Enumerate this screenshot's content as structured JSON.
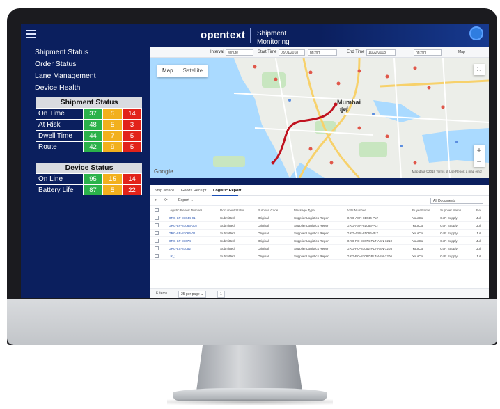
{
  "topbar": {
    "brand": "opentext",
    "app_title": "Shipment Monitoring"
  },
  "sidebar": {
    "nav": [
      "Shipment Status",
      "Order Status",
      "Lane Management",
      "Device Health"
    ],
    "shipment_status": {
      "title": "Shipment Status",
      "rows": [
        {
          "label": "On Time",
          "green": "37",
          "yellow": "5",
          "red": "14"
        },
        {
          "label": "At Risk",
          "green": "48",
          "yellow": "5",
          "red": "3"
        },
        {
          "label": "Dwell Time",
          "green": "44",
          "yellow": "7",
          "red": "5"
        },
        {
          "label": "Route",
          "green": "42",
          "yellow": "9",
          "red": "5"
        }
      ]
    },
    "device_status": {
      "title": "Device Status",
      "rows": [
        {
          "label": "On Line",
          "green": "95",
          "yellow": "15",
          "red": "14"
        },
        {
          "label": "Battery Life",
          "green": "87",
          "yellow": "5",
          "red": "22"
        }
      ]
    }
  },
  "filters": {
    "interval_label": "Interval",
    "interval_value": "Minute",
    "start_label": "Start Time",
    "start_value": "08/01/2018",
    "start_time_placeholder": "hh:mm",
    "end_label": "End Time",
    "end_value": "10/22/2018",
    "end_time_placeholder": "hh:mm",
    "map_button": "Map"
  },
  "map": {
    "tab_map": "Map",
    "tab_satellite": "Satellite",
    "city": "Mumbai",
    "city_local": "मुंबई",
    "google": "Google",
    "terms": "Map data ©2018   Terms of Use   Report a map error",
    "zoom_in": "+",
    "zoom_out": "−"
  },
  "documents": {
    "tabs": [
      "Ship Notice",
      "Goods Receipt",
      "Logistic Report"
    ],
    "active_tab": "Logistic Report",
    "export_label": "Export ⌄",
    "filter_value": "All Documents",
    "columns": [
      "Logistic Report Number",
      "Document Status",
      "Purpose Code",
      "Message Type",
      "ASN Number",
      "Buyer Name",
      "Supplier Name",
      "Re"
    ],
    "rows": [
      [
        "GRG-LP-81044-01",
        "Submitted",
        "Original",
        "Supplier Logistics Report",
        "GRG-ASN-81044-PLT",
        "YourCo",
        "GoR Supply",
        "Jul"
      ],
      [
        "GRG-LP-81066-002",
        "Submitted",
        "Original",
        "Supplier Logistics Report",
        "GRG-ASN-81066-PLT",
        "YourCo",
        "GoR Supply",
        "Jul"
      ],
      [
        "GRG-LP-81066-01",
        "Submitted",
        "Original",
        "Supplier Logistics Report",
        "GRG-ASN-81066-PLT",
        "YourCo",
        "GoR Supply",
        "Jul"
      ],
      [
        "GRG-LP-81074",
        "Submitted",
        "Original",
        "Supplier Logistics Report",
        "GRG-PO-81074-PLT-ASN-1210",
        "YourCo",
        "GoR Supply",
        "Jul"
      ],
      [
        "GRG-LS-81052",
        "Submitted",
        "Original",
        "Supplier Logistics Report",
        "GRG-PO-81052-PLT-ASN-1208",
        "YourCo",
        "GoR Supply",
        "Jul"
      ],
      [
        "LR_1",
        "Submitted",
        "Original",
        "Supplier Logistics Report",
        "GRG-PO-81087-PLT-ASN-1206",
        "YourCo",
        "GoR Supply",
        "Jul"
      ]
    ],
    "pager": {
      "items": "6 items",
      "per_page": "25 per page ⌄",
      "page": "1"
    }
  },
  "colors": {
    "navy": "#0b1f5e",
    "green": "#2bb24a",
    "yellow": "#f2b01d",
    "red": "#e2231a",
    "route": "#c0121f"
  }
}
